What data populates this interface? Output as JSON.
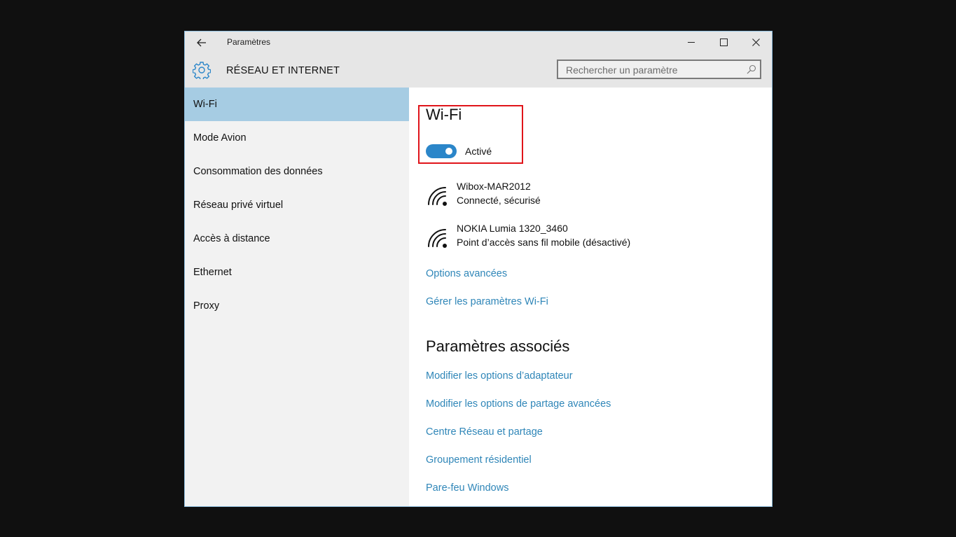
{
  "window": {
    "title": "Paramètres",
    "section_title": "RÉSEAU ET INTERNET",
    "controls": {
      "minimize": "minimize",
      "maximize": "maximize",
      "close": "close"
    }
  },
  "search": {
    "placeholder": "Rechercher un paramètre",
    "value": ""
  },
  "sidebar": {
    "items": [
      {
        "label": "Wi-Fi",
        "active": true
      },
      {
        "label": "Mode Avion"
      },
      {
        "label": "Consommation des données"
      },
      {
        "label": "Réseau privé virtuel"
      },
      {
        "label": "Accès à distance"
      },
      {
        "label": "Ethernet"
      },
      {
        "label": "Proxy"
      }
    ]
  },
  "main": {
    "heading": "Wi-Fi",
    "toggle": {
      "state": "on",
      "label": "Activé"
    },
    "networks": [
      {
        "name": "Wibox-MAR2012",
        "status": "Connecté, sécurisé"
      },
      {
        "name": "NOKIA Lumia 1320_3460",
        "status": "Point d’accès sans fil mobile (désactivé)"
      }
    ],
    "links": [
      "Options avancées",
      "Gérer les paramètres Wi-Fi"
    ],
    "related": {
      "heading": "Paramètres associés",
      "links": [
        "Modifier les options d’adaptateur",
        "Modifier les options de partage avancées",
        "Centre Réseau et partage",
        "Groupement résidentiel",
        "Pare-feu Windows"
      ]
    }
  },
  "colors": {
    "accent": "#2b86c9",
    "link": "#2f86b8",
    "selected": "#a6cce3",
    "highlight_box": "#e0141a"
  }
}
